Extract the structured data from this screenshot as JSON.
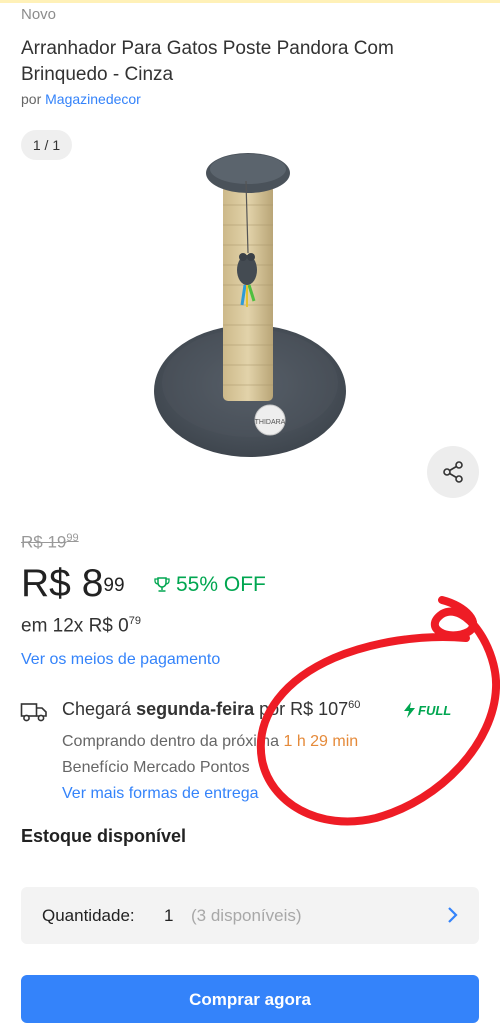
{
  "product": {
    "condition": "Novo",
    "title": "Arranhador Para Gatos Poste Pandora Com Brinquedo - Cinza",
    "seller_prefix": "por",
    "seller_name": "Magazinedecor",
    "gallery_counter": "1 / 1",
    "image_icon": "cat-scratching-post-image"
  },
  "pricing": {
    "old_price_int": "R$ 19",
    "old_price_cents": "99",
    "price_int": "R$ 8",
    "price_cents": "99",
    "discount": "55% OFF",
    "installments_int": "em 12x R$ 0",
    "installments_cents": "79",
    "payment_link": "Ver os meios de pagamento"
  },
  "shipping": {
    "prefix": "Chegará",
    "day": "segunda-feira",
    "price_prefix": "por R$ 107",
    "price_cents": "60",
    "full_label": "FULL",
    "sub1_prefix": "Comprando dentro da próxima",
    "sub1_timer": "1 h 29 min",
    "sub2": "Benefício Mercado Pontos",
    "more_link": "Ver mais formas de entrega"
  },
  "stock": {
    "title": "Estoque disponível",
    "quantity_label": "Quantidade:",
    "quantity_value": "1",
    "available": "(3 disponíveis)"
  },
  "buy_button": "Comprar agora",
  "colors": {
    "link": "#3483fa",
    "discount": "#00a650",
    "timer": "#e58a3a",
    "annotation": "#ee1c25"
  }
}
